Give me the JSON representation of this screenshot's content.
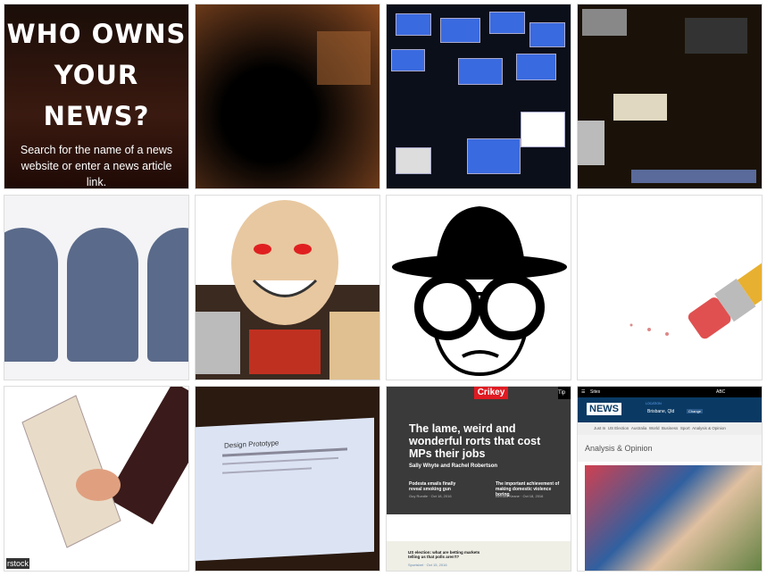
{
  "hero": {
    "title": "WHO OWNS YOUR NEWS?",
    "subtitle": "Search for the name of a news website or enter a news article link."
  },
  "tiles": {
    "prototype": {
      "title": "Design Prototype"
    },
    "stock_watermark": "rstock",
    "crikey": {
      "logo": "Crikey",
      "tip": "Tip",
      "headline": "The lame, weird and wonderful rorts that cost MPs their jobs",
      "byline": "Sally Whyte and Rachel Robertson",
      "story1": "Podesta emails finally reveal smoking gun",
      "story1_meta": "Guy Rundle · Oct 18, 2016",
      "story2": "The important achievement of making domestic violence boring",
      "story2_meta": "Bernard Keane · Oct 18, 2016",
      "story3": "US election: what are betting markets telling us that polls aren't?",
      "story3_meta": "Sportsbet · Oct 15, 2016"
    },
    "abc": {
      "sites": "Sites",
      "abc_logo": "ABC",
      "news_logo": "NEWS",
      "location_label": "LOCATION",
      "location": "Brisbane, Qld",
      "change": "Change",
      "nav": [
        "Just In",
        "US Election",
        "Australia",
        "World",
        "Business",
        "Sport",
        "Analysis & Opinion"
      ],
      "section": "Analysis & Opinion"
    }
  },
  "colors": {
    "crikey_red": "#e01a22",
    "abc_blue": "#0a3a64"
  }
}
